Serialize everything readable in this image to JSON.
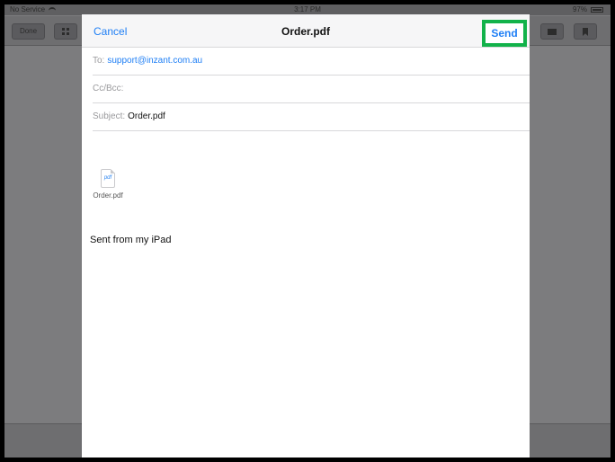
{
  "status_bar": {
    "carrier": "No Service",
    "time": "3:17 PM",
    "battery": "97%",
    "battery_level": 0.97
  },
  "background_toolbar": {
    "done_label": "Done"
  },
  "compose": {
    "cancel_label": "Cancel",
    "title": "Order.pdf",
    "send_label": "Send",
    "to_label": "To:",
    "to_value": "support@inzant.com.au",
    "cc_label": "Cc/Bcc:",
    "subject_label": "Subject:",
    "subject_value": "Order.pdf",
    "attachment": {
      "icon_text": "pdf",
      "name": "Order.pdf"
    },
    "signature": "Sent from my iPad"
  },
  "icons": [
    "wifi-icon",
    "battery-icon",
    "grid-icon",
    "mail-icon",
    "bookmark-icon",
    "pdf-file-icon"
  ],
  "colors": {
    "accent": "#1f7ff5",
    "highlight_border": "#12b24a"
  }
}
